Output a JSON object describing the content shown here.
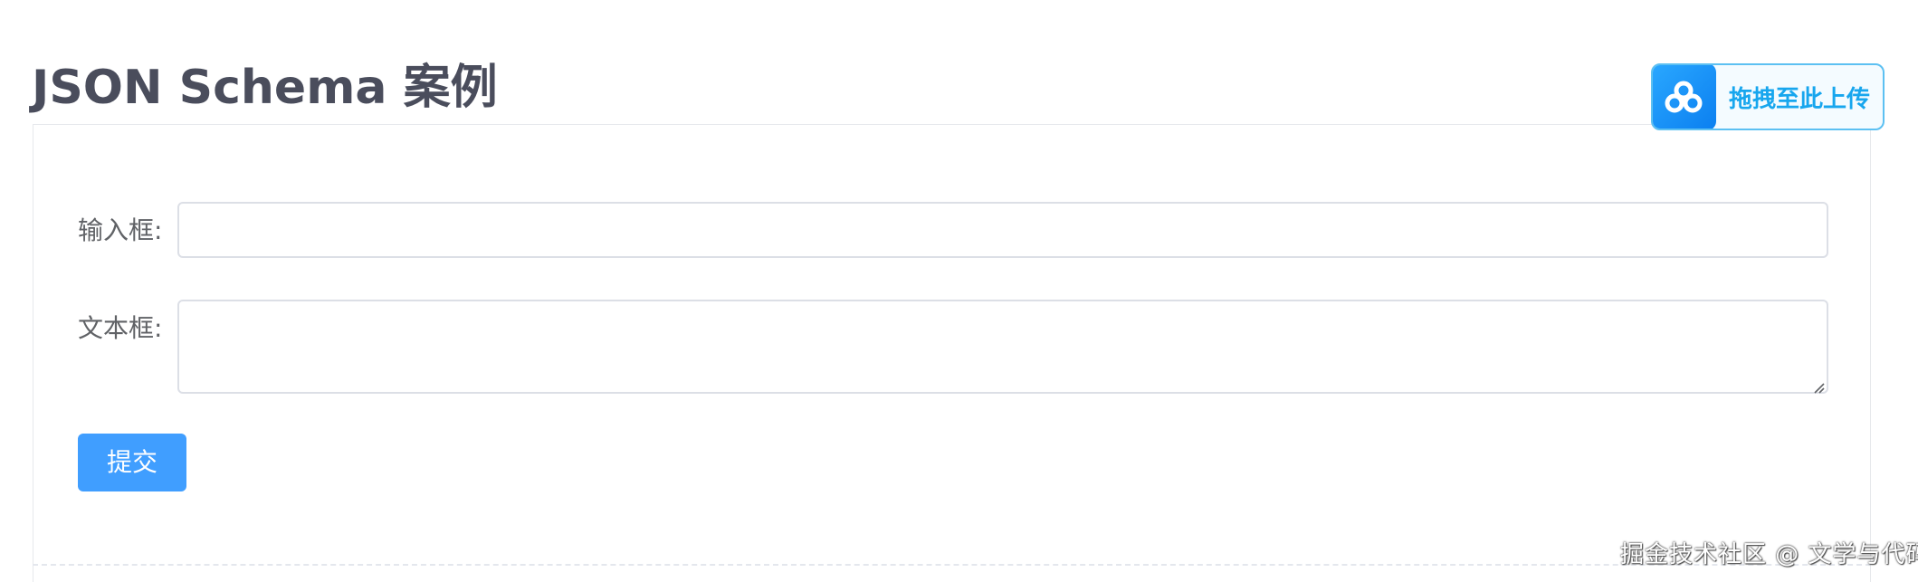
{
  "page": {
    "title": "JSON Schema 案例"
  },
  "form": {
    "input": {
      "label": "输入框:",
      "value": "",
      "placeholder": ""
    },
    "textarea": {
      "label": "文本框:",
      "value": "",
      "placeholder": ""
    },
    "submit_label": "提交"
  },
  "upload": {
    "label": "拖拽至此上传",
    "icon": "cloud-icon"
  },
  "watermark": {
    "text": "掘金技术社区 @ 文学与代码"
  },
  "colors": {
    "primary": "#409eff",
    "title": "#4a4d5c",
    "label": "#606266",
    "border": "#dcdfe6",
    "upload_accent": "#17a6ee"
  }
}
